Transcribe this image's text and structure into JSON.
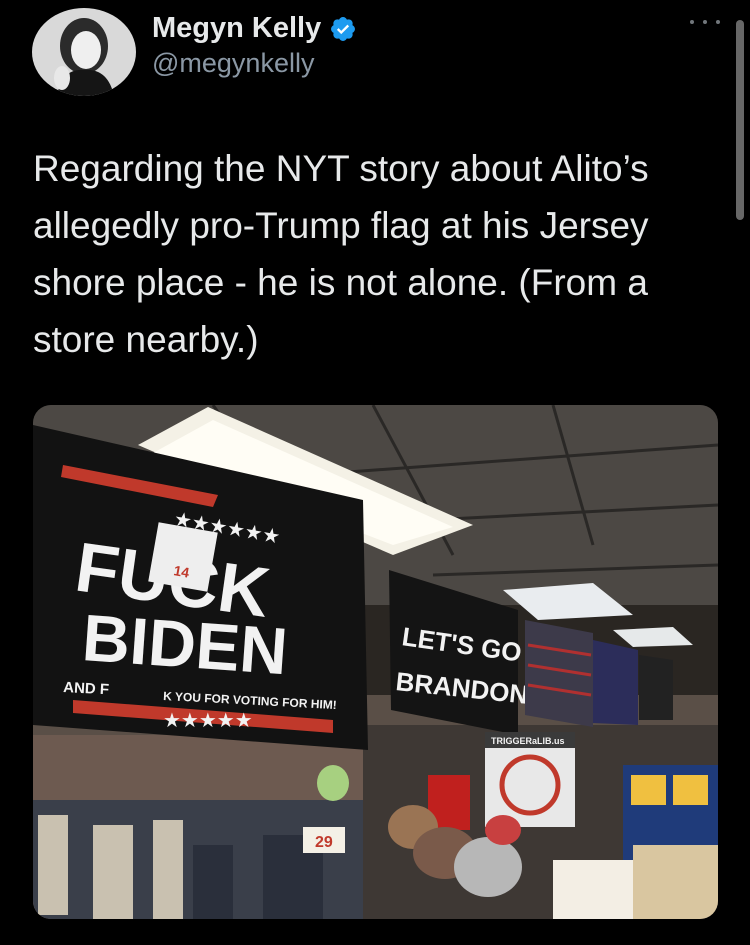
{
  "author": {
    "display_name": "Megyn Kelly",
    "handle": "@megynkelly",
    "verified": true,
    "avatar_icon": "avatar-portrait"
  },
  "menu": {
    "icon": "more-horizontal-icon"
  },
  "tweet": {
    "text": "Regarding the NYT story about Alito’s allegedly pro-Trump flag at his Jersey shore place - he is not alone. (From a store nearby.)"
  },
  "media": {
    "alt_icon": "photo",
    "flag_left": {
      "line1": "FUCK",
      "line2": "BIDEN",
      "tagline": "AND F",
      "tagline2": "K YOU FOR VOTING FOR HIM!",
      "stars": "★★★★★★",
      "stars_bottom": "★★★★★",
      "price_tag": "14"
    },
    "flag_middle": {
      "line1": "LET'S GO",
      "line2": "BRANDON"
    },
    "sign_right": "TRIGGERaLIB.us",
    "price_sign": "29"
  },
  "colors": {
    "background": "#000000",
    "text": "#e7e9ea",
    "muted": "#8b98a5",
    "verified": "#1d9bf0"
  }
}
